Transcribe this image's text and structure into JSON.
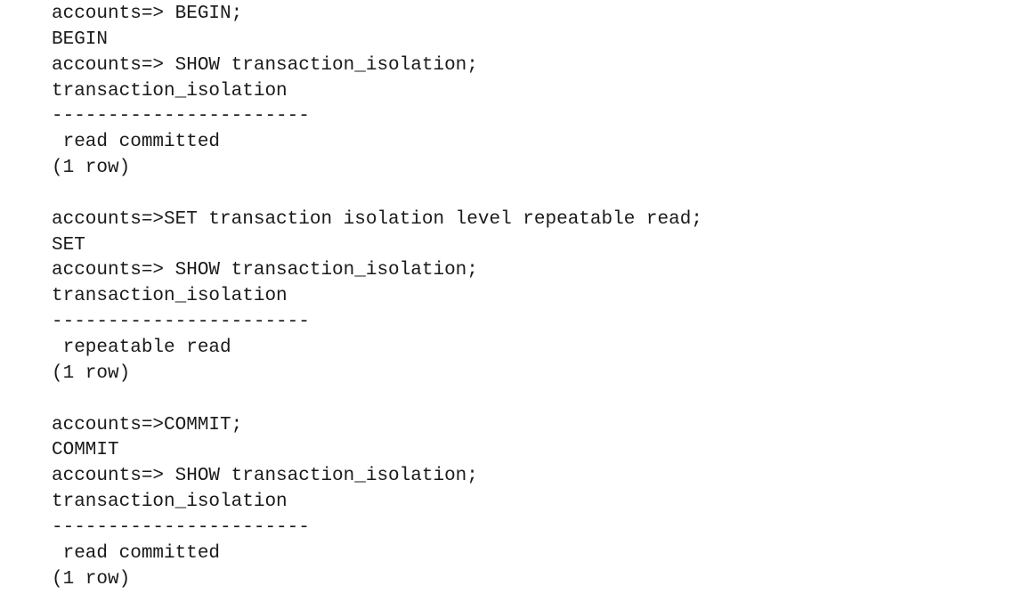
{
  "terminal": {
    "lines": [
      "accounts=> BEGIN;",
      "BEGIN",
      "accounts=> SHOW transaction_isolation;",
      "transaction_isolation",
      "-----------------------",
      " read committed",
      "(1 row)",
      "",
      "accounts=>SET transaction isolation level repeatable read;",
      "SET",
      "accounts=> SHOW transaction_isolation;",
      "transaction_isolation",
      "-----------------------",
      " repeatable read",
      "(1 row)",
      "",
      "accounts=>COMMIT;",
      "COMMIT",
      "accounts=> SHOW transaction_isolation;",
      "transaction_isolation",
      "-----------------------",
      " read committed",
      "(1 row)"
    ]
  }
}
